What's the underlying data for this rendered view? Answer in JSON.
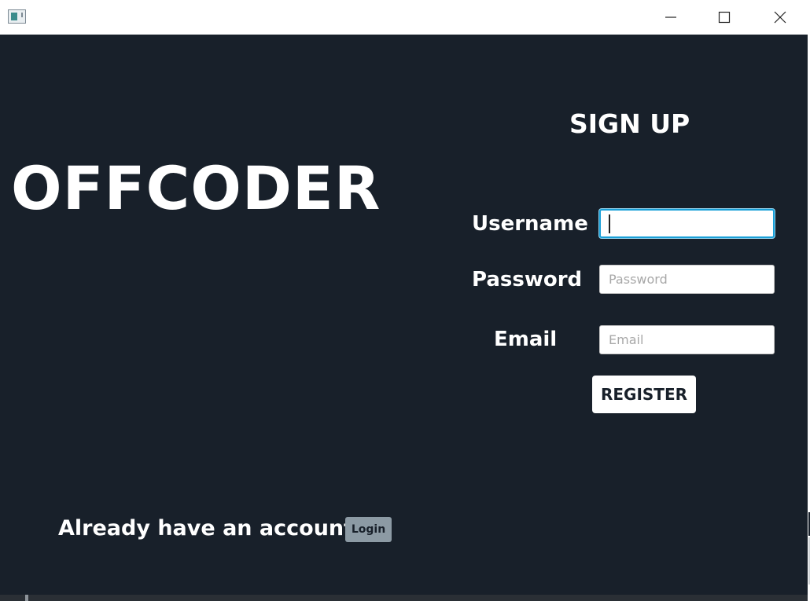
{
  "window": {
    "icon": "app-icon",
    "controls": {
      "minimize": "minimize-icon",
      "maximize": "maximize-icon",
      "close": "close-icon"
    }
  },
  "brand": {
    "logo_text": "OFFCODER"
  },
  "signup": {
    "title": "SIGN UP",
    "username_label": "Username",
    "username_value": "",
    "password_label": "Password",
    "password_placeholder": "Password",
    "email_label": "Email",
    "email_placeholder": "Email",
    "register_label": "REGISTER"
  },
  "footer": {
    "already_text": "Already have an account?",
    "login_label": "Login"
  },
  "colors": {
    "background": "#18202a",
    "text": "#ffffff",
    "focus_border": "#1aa0d8",
    "login_button": "#8c9aa4"
  }
}
